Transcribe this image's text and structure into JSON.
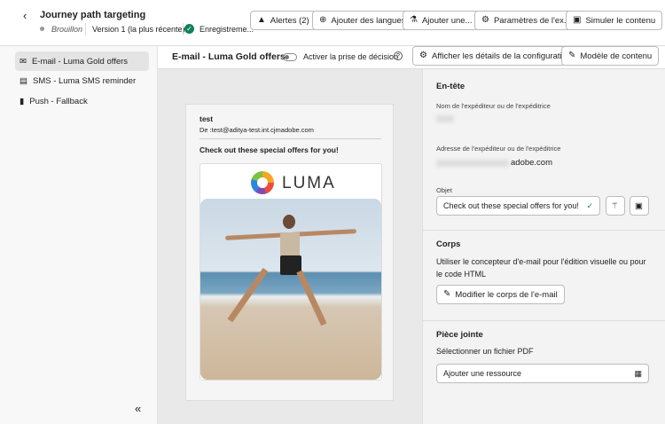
{
  "header": {
    "title": "Journey path targeting",
    "status": "Brouillon",
    "version": "Version 1 (la plus récente)",
    "saved": "Enregistreme...",
    "buttons": [
      {
        "label": "Alertes  (2)",
        "icon": "warning-icon"
      },
      {
        "label": "Ajouter des langues",
        "icon": "globe-icon"
      },
      {
        "label": "Ajouter une...",
        "icon": "experiment-icon"
      },
      {
        "label": "Paramètres de l'ex...",
        "icon": "settings-icon"
      },
      {
        "label": "Simuler le contenu",
        "icon": "simulate-icon"
      }
    ]
  },
  "sidebar": {
    "items": [
      {
        "label": "E-mail - Luma Gold offers",
        "icon": "email-icon"
      },
      {
        "label": "SMS - Luma SMS reminder",
        "icon": "sms-icon"
      },
      {
        "label": "Push - Fallback",
        "icon": "push-icon"
      }
    ],
    "collapse": "«"
  },
  "toolbar": {
    "title": "E-mail - Luma Gold offers",
    "toggle_label": "Activer la prise de décision",
    "toggle_on": false,
    "config_button": "Afficher les détails de la configuration",
    "template_button": "Modèle de contenu"
  },
  "preview": {
    "sender": "test",
    "from": "De :test@aditya-test.int.cjmadobe.com",
    "subject": "Check out these special offers for you!",
    "logo_text": "LUMA"
  },
  "panel": {
    "header_title": "En-tête",
    "sender_name_label": "Nom de l'expéditeur ou de l'expéditrice",
    "sender_address_label": "Adresse de l'expéditeur ou de l'expéditrice",
    "sender_address_suffix": "adobe.com",
    "subject_label": "Objet",
    "subject_value": "Check out these special offers for you!",
    "body_title": "Corps",
    "body_desc": "Utiliser le concepteur d'e-mail pour l'édition visuelle ou pour le code HTML",
    "edit_body_button": "Modifier le corps de l'e-mail",
    "attachment_title": "Pièce jointe",
    "attachment_desc": "Sélectionner un fichier PDF",
    "attachment_button": "Ajouter une ressource"
  },
  "colors": {
    "success": "#12805c",
    "accent": "#1473e6"
  }
}
